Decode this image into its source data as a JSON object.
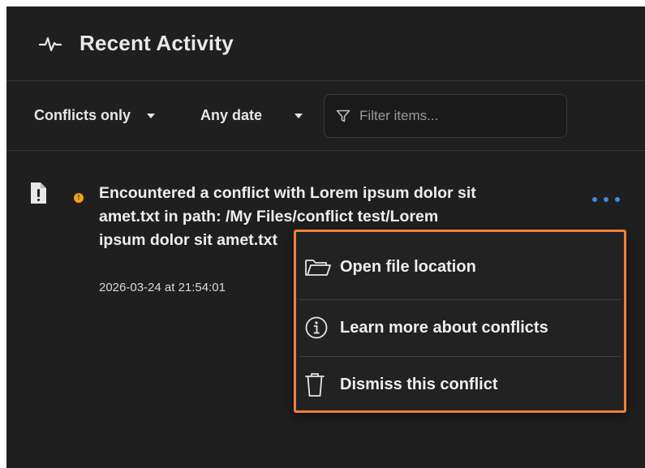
{
  "header": {
    "title": "Recent Activity",
    "icon": "activity-pulse-icon"
  },
  "filters": {
    "type_filter": "Conflicts only",
    "date_filter": "Any date",
    "search_placeholder": "Filter items...",
    "search_value": ""
  },
  "entry": {
    "status": "warning",
    "status_glyph": "!",
    "message": "Encountered a conflict with Lorem ipsum dolor sit amet.txt in path: /My Files/conflict test/Lorem ipsum dolor sit amet.txt",
    "timestamp": "2026-03-24 at 21:54:01"
  },
  "menu": {
    "items": [
      {
        "label": "Open file location",
        "icon": "folder-open-icon"
      },
      {
        "label": "Learn more about conflicts",
        "icon": "info-circle-icon"
      },
      {
        "label": "Dismiss this conflict",
        "icon": "trash-icon"
      }
    ]
  },
  "colors": {
    "background": "#1f1f1f",
    "accent": "#3d8be8",
    "warning": "#f0a21c",
    "highlight_border": "#f0813a"
  }
}
